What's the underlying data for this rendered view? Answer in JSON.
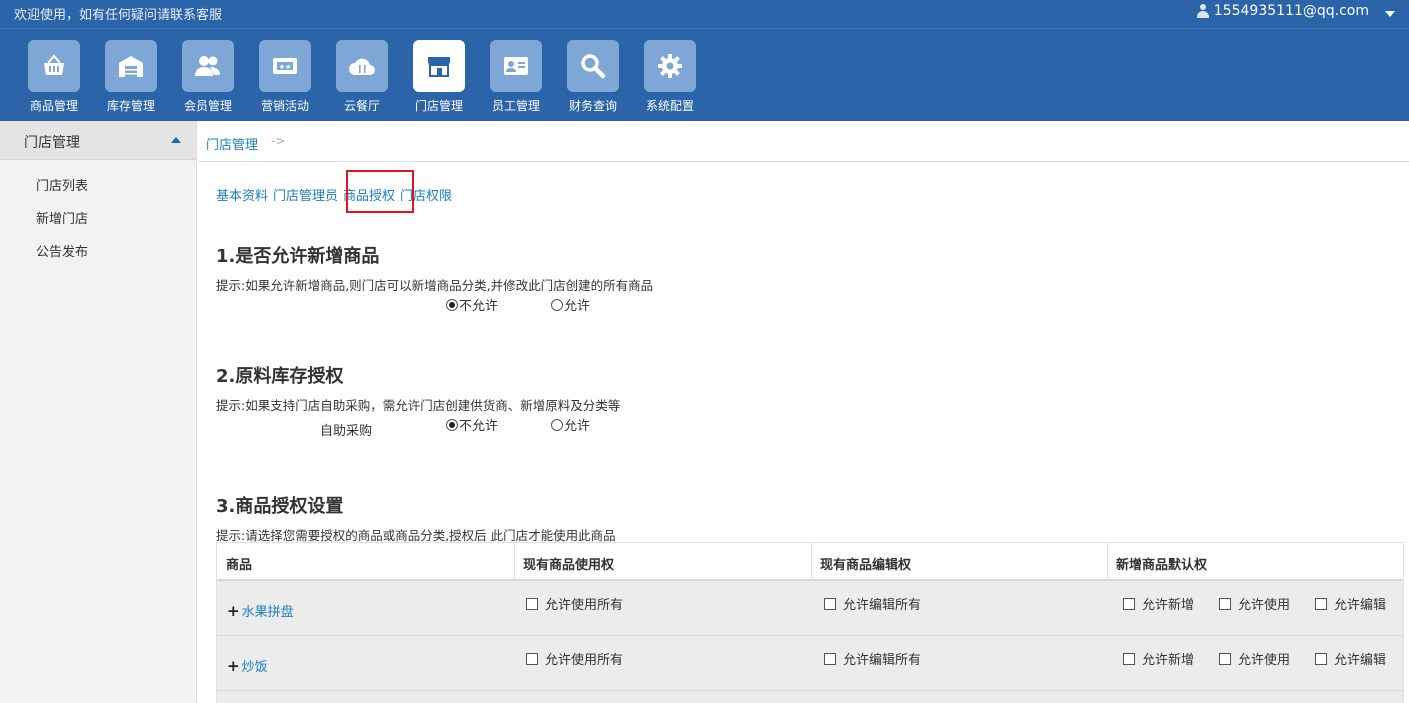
{
  "topbar": {
    "welcome": "欢迎使用，如有任何疑问请联系客服",
    "user_email": "1554935111@qq.com"
  },
  "nav": {
    "items": [
      {
        "label": "商品管理",
        "icon": "basket-icon"
      },
      {
        "label": "库存管理",
        "icon": "warehouse-icon"
      },
      {
        "label": "会员管理",
        "icon": "members-icon"
      },
      {
        "label": "营销活动",
        "icon": "ticket-icon"
      },
      {
        "label": "云餐厅",
        "icon": "cloud-dining-icon"
      },
      {
        "label": "门店管理",
        "icon": "storefront-icon",
        "active": true
      },
      {
        "label": "员工管理",
        "icon": "id-card-icon"
      },
      {
        "label": "财务查询",
        "icon": "search-icon"
      },
      {
        "label": "系统配置",
        "icon": "gear-icon"
      }
    ]
  },
  "sidebar": {
    "title": "门店管理",
    "items": [
      "门店列表",
      "新增门店",
      "公告发布"
    ]
  },
  "breadcrumb": {
    "link": "门店管理",
    "sep": "->"
  },
  "tabs": [
    "基本资料",
    "门店管理员",
    "商品授权",
    "门店权限"
  ],
  "section1": {
    "title": "1.是否允许新增商品",
    "hint": "提示:如果允许新增商品,则门店可以新增商品分类,并修改此门店创建的所有商品",
    "opt_no": "不允许",
    "opt_yes": "允许"
  },
  "section2": {
    "title": "2.原料库存授权",
    "hint": "提示:如果支持门店自助采购，需允许门店创建供货商、新增原料及分类等",
    "label": "自助采购",
    "opt_no": "不允许",
    "opt_yes": "允许"
  },
  "section3": {
    "title": "3.商品授权设置",
    "hint": "提示:请选择您需要授权的商品或商品分类,授权后 此门店才能使用此商品"
  },
  "table": {
    "headers": [
      "商品",
      "现有商品使用权",
      "现有商品编辑权",
      "新增商品默认权"
    ],
    "rows": [
      {
        "name": "水果拼盘"
      },
      {
        "name": "炒饭"
      }
    ],
    "cb_use_all": "允许使用所有",
    "cb_edit_all": "允许编辑所有",
    "cb_new": "允许新增",
    "cb_use": "允许使用",
    "cb_edit": "允许编辑"
  }
}
